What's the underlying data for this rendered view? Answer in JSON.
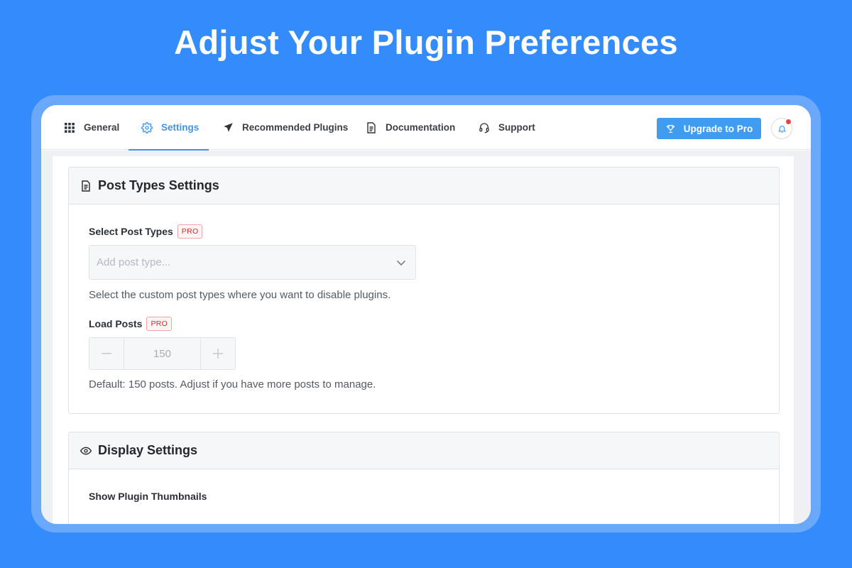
{
  "hero": {
    "title": "Adjust Your Plugin Preferences"
  },
  "nav": {
    "items": [
      {
        "label": "General",
        "icon": "grid-icon"
      },
      {
        "label": "Settings",
        "icon": "gear-icon",
        "active": true
      },
      {
        "label": "Recommended Plugins",
        "icon": "paper-plane-icon"
      },
      {
        "label": "Documentation",
        "icon": "document-icon"
      },
      {
        "label": "Support",
        "icon": "headset-icon"
      }
    ],
    "upgrade_label": "Upgrade to Pro",
    "upgrade_icon": "trophy-icon",
    "notification_icon": "bell-icon"
  },
  "post_types_card": {
    "title": "Post Types Settings",
    "icon": "document-icon",
    "select_label": "Select Post Types",
    "select_badge": "PRO",
    "select_placeholder": "Add post type...",
    "select_help": "Select the custom post types where you want to disable plugins.",
    "load_label": "Load Posts",
    "load_badge": "PRO",
    "load_value": "150",
    "load_help": "Default: 150 posts. Adjust if you have more posts to manage."
  },
  "display_card": {
    "title": "Display Settings",
    "icon": "eye-icon",
    "thumbnails_label": "Show Plugin Thumbnails"
  },
  "colors": {
    "background": "#348bfc",
    "accent": "#3f95ee",
    "button": "#3f9cf1",
    "pro_badge": "#dc2626",
    "notification_dot": "#ef4444"
  }
}
